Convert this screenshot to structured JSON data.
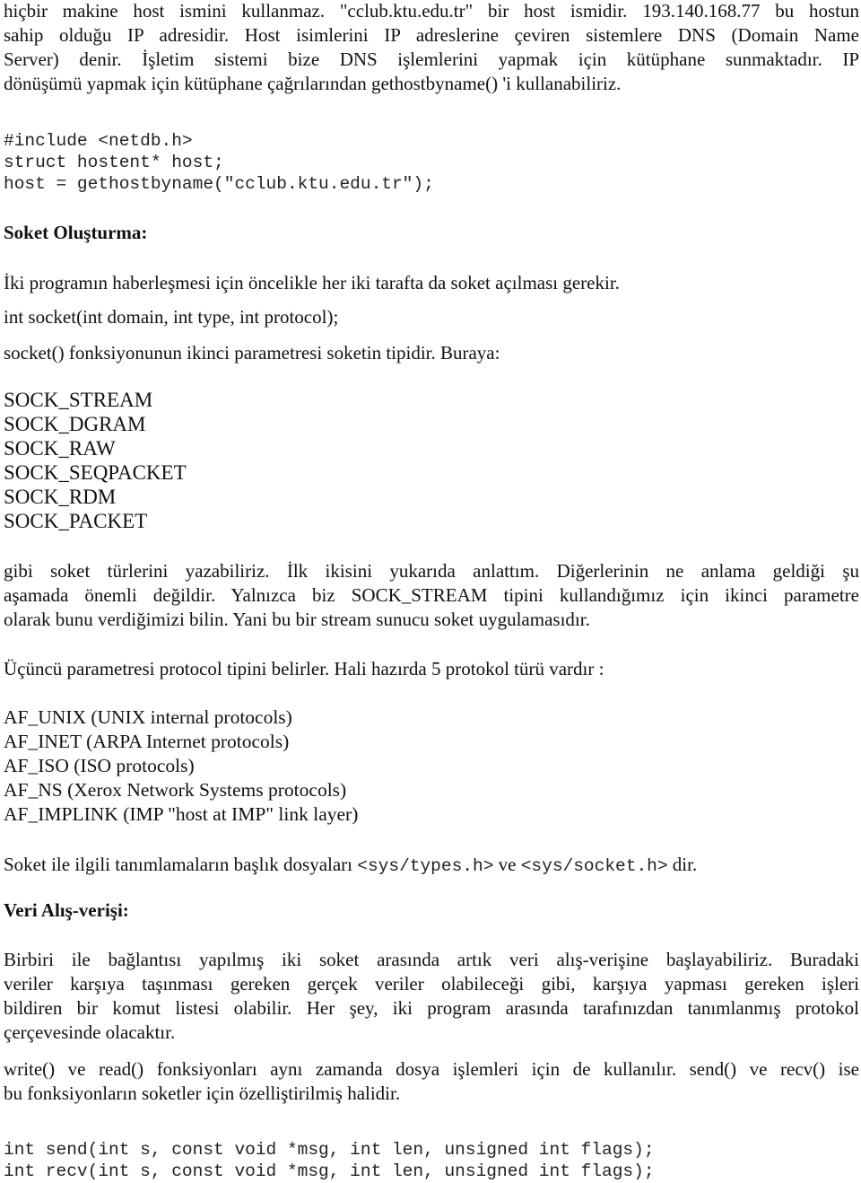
{
  "intro": {
    "lines": [
      "hiçbir makine host ismini kullanmaz. \"cclub.ktu.edu.tr\" bir host ismidir. 193.140.168.77 bu hostun",
      "sahip olduğu IP adresidir. Host isimlerini IP adreslerine çeviren sistemlere DNS (Domain Name",
      "Server) denir.  İşletim sistemi bize DNS işlemlerini yapmak için kütüphane sunmaktadır. IP",
      "dönüşümü yapmak için kütüphane çağrılarından gethostbyname() 'i kullanabiliriz."
    ]
  },
  "code_gethost": [
    "#include <netdb.h>",
    "struct hostent* host;",
    "host = gethostbyname(\"cclub.ktu.edu.tr\");"
  ],
  "section_socket": {
    "heading": "Soket Oluşturma:",
    "para1": "İki programın haberleşmesi için öncelikle her iki tarafta da soket açılması gerekir.",
    "signature": "int socket(int domain, int type, int protocol);",
    "para2": "socket() fonksiyonunun ikinci parametresi soketin tipidir. Buraya:",
    "socket_types": [
      "SOCK_STREAM",
      "SOCK_DGRAM",
      "SOCK_RAW",
      "SOCK_SEQPACKET",
      "SOCK_RDM",
      "SOCK_PACKET"
    ],
    "para3_lines": [
      "gibi soket türlerini yazabiliriz. İlk ikisini yukarıda anlattım. Diğerlerinin ne anlama geldiği şu",
      "aşamada önemli değildir. Yalnızca biz SOCK_STREAM tipini kullandığımız için ikinci parametre",
      "olarak bunu verdiğimizi bilin. Yani bu bir stream sunucu soket uygulamasıdır."
    ],
    "para4": "Üçüncü parametresi protocol tipini belirler. Hali hazırda 5 protokol türü vardır :",
    "protocols": [
      "AF_UNIX (UNIX internal protocols)",
      "AF_INET (ARPA Internet protocols)",
      "AF_ISO (ISO protocols)",
      "AF_NS (Xerox Network Systems protocols)",
      "AF_IMPLINK (IMP \"host at IMP\" link layer)"
    ],
    "headers_prefix": "Soket ile ilgili tanımlamaların başlık dosyaları ",
    "header1": "<sys/types.h>",
    "headers_mid": " ve ",
    "header2": "<sys/socket.h>",
    "headers_suffix": " dir."
  },
  "section_data": {
    "heading": "Veri Alış-verişi:",
    "para1_lines": [
      "Birbiri ile bağlantısı yapılmış iki soket arasında artık veri alış-verişine başlayabiliriz. Buradaki",
      "veriler karşıya taşınması gereken gerçek veriler olabileceği gibi, karşıya yapması gereken işleri",
      "bildiren bir komut listesi olabilir. Her şey, iki program arasında tarafınızdan tanımlanmış protokol",
      "çerçevesinde olacaktır."
    ],
    "para2_lines": [
      "write() ve read() fonksiyonları aynı zamanda dosya işlemleri için de kullanılır.  send() ve recv() ise",
      "bu fonksiyonların soketler için özelliştirilmiş halidir."
    ],
    "code": [
      "int send(int s, const void *msg, int len, unsigned int flags);",
      "int recv(int s, const void *msg, int len, unsigned int flags);"
    ]
  }
}
